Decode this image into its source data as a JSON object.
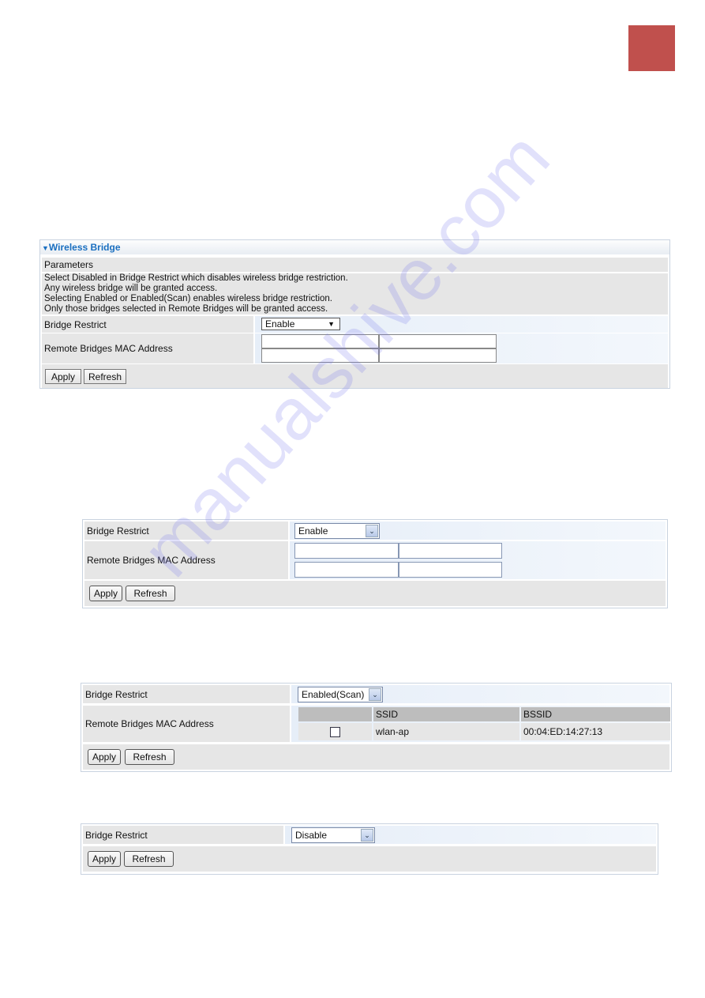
{
  "page_tab_color": "#c0504d",
  "watermark": "manualshive.com",
  "panel1": {
    "title": "Wireless Bridge",
    "section": "Parameters",
    "description": [
      "Select Disabled in Bridge Restrict which disables wireless bridge restriction.",
      "Any wireless bridge will be granted access.",
      "Selecting Enabled or Enabled(Scan) enables wireless bridge restriction.",
      "Only those bridges selected in Remote Bridges will be granted access."
    ],
    "bridge_restrict_label": "Bridge Restrict",
    "bridge_restrict_value": "Enable",
    "mac_label": "Remote Bridges MAC Address",
    "mac_values": [
      "",
      "",
      "",
      ""
    ],
    "apply": "Apply",
    "refresh": "Refresh"
  },
  "panel2": {
    "bridge_restrict_label": "Bridge Restrict",
    "bridge_restrict_value": "Enable",
    "mac_label": "Remote Bridges MAC Address",
    "mac_values": [
      "",
      "",
      "",
      ""
    ],
    "apply": "Apply",
    "refresh": "Refresh"
  },
  "panel3": {
    "bridge_restrict_label": "Bridge Restrict",
    "bridge_restrict_value": "Enabled(Scan)",
    "mac_label": "Remote Bridges MAC Address",
    "table": {
      "headers": [
        "",
        "SSID",
        "BSSID"
      ],
      "rows": [
        {
          "checked": false,
          "ssid": "wlan-ap",
          "bssid": "00:04:ED:14:27:13"
        }
      ]
    },
    "apply": "Apply",
    "refresh": "Refresh"
  },
  "panel4": {
    "bridge_restrict_label": "Bridge Restrict",
    "bridge_restrict_value": "Disable",
    "apply": "Apply",
    "refresh": "Refresh"
  }
}
